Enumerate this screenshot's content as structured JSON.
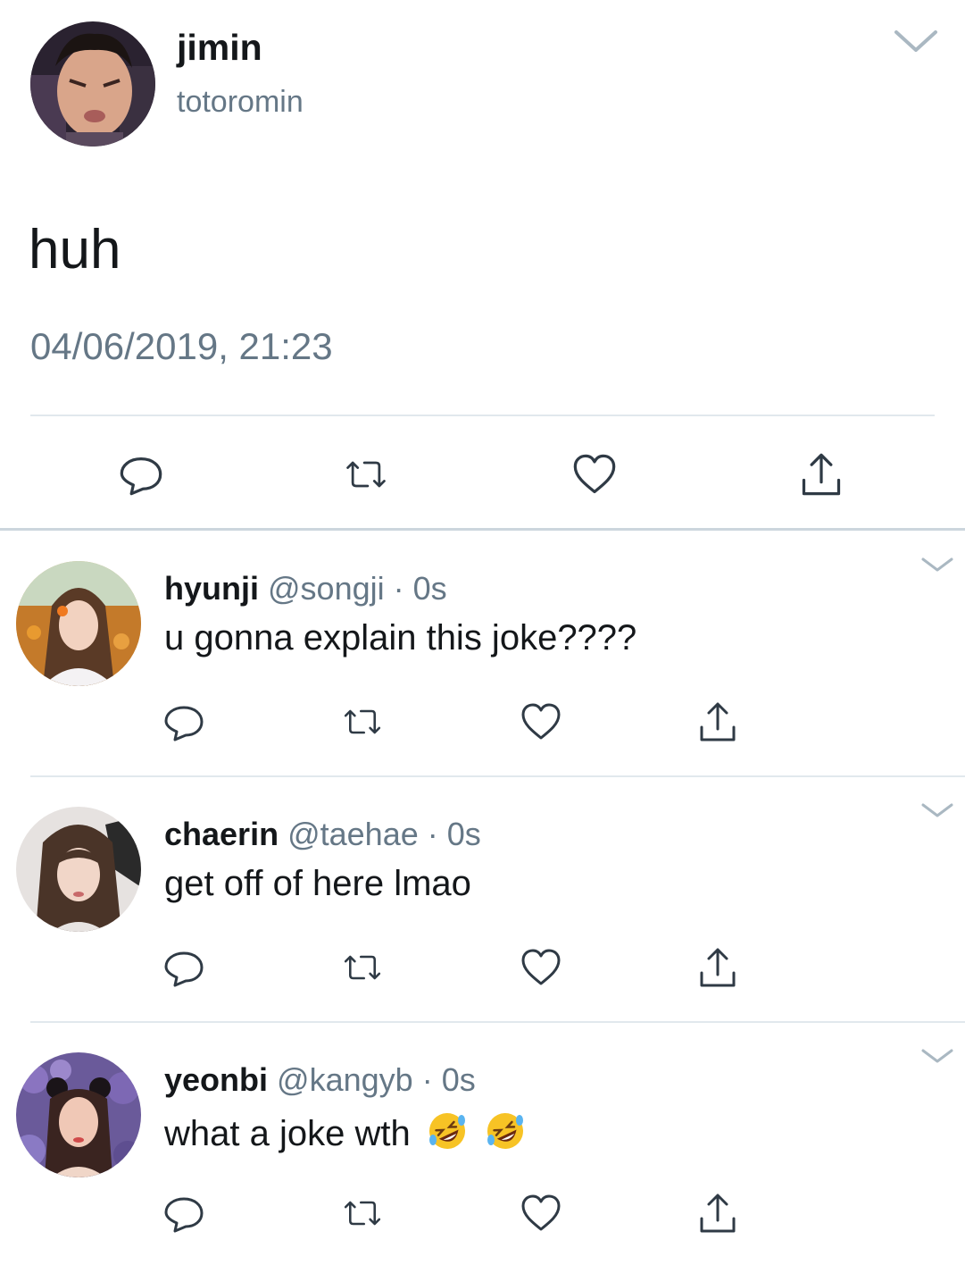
{
  "main_tweet": {
    "display_name": "jimin",
    "username": "totoromin",
    "text": "huh",
    "timestamp": "04/06/2019, 21:23",
    "actions": [
      "reply-icon",
      "retweet-icon",
      "like-icon",
      "share-icon"
    ]
  },
  "replies": [
    {
      "display_name": "hyunji",
      "handle": "@songji",
      "separator": "·",
      "time": "0s",
      "text": "u gonna explain this joke????"
    },
    {
      "display_name": "chaerin",
      "handle": "@taehae",
      "separator": "·",
      "time": "0s",
      "text": "get off of here lmao"
    },
    {
      "display_name": "yeonbi",
      "handle": "@kangyb",
      "separator": "·",
      "time": "0s",
      "text": "what a joke wth",
      "emojis": [
        "rolling-on-floor-laughing-emoji",
        "rolling-on-floor-laughing-emoji"
      ]
    }
  ],
  "colors": {
    "text": "#14171a",
    "secondary": "#657786",
    "icon": "#2f3a45",
    "divider": "#e1e8ed"
  }
}
